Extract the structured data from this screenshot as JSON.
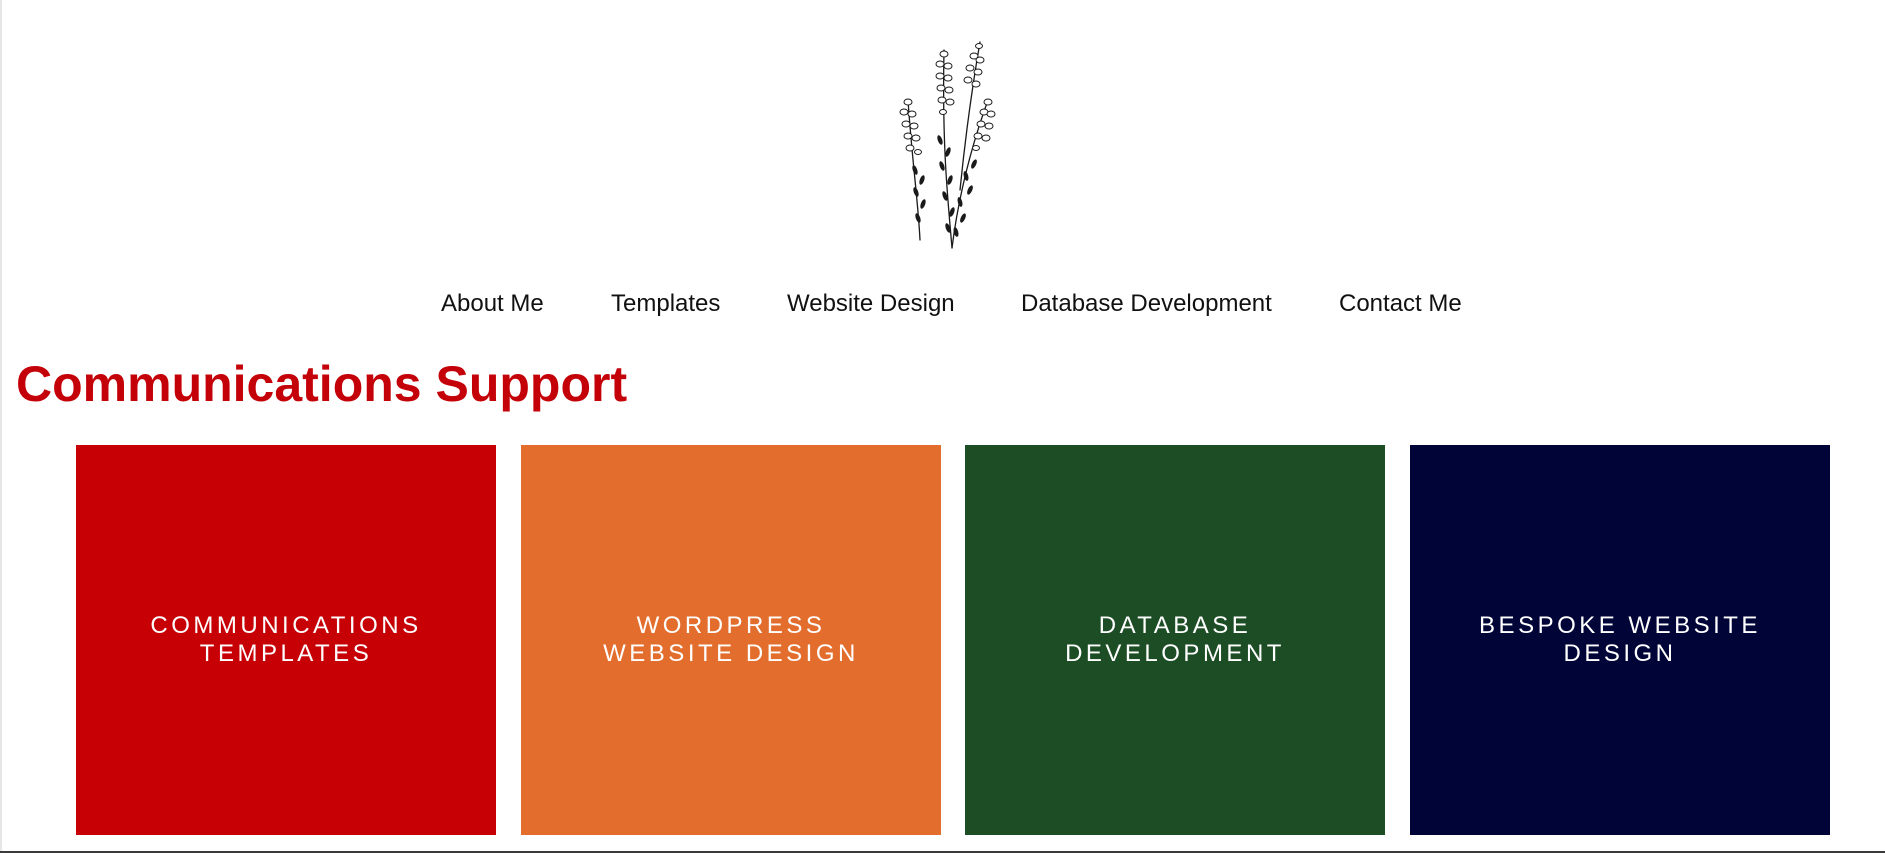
{
  "nav": {
    "items": [
      {
        "label": "About Me"
      },
      {
        "label": "Templates"
      },
      {
        "label": "Website Design"
      },
      {
        "label": "Database Development"
      },
      {
        "label": "Contact Me"
      }
    ]
  },
  "main": {
    "title": "Communications Support",
    "title_color": "#c40008",
    "tiles": [
      {
        "line1": "COMMUNICATIONS",
        "line2": "TEMPLATES",
        "color": "#c70006"
      },
      {
        "line1": "WORDPRESS",
        "line2": "WEBSITE DESIGN",
        "color": "#e36d2c"
      },
      {
        "line1": "DATABASE",
        "line2": "DEVELOPMENT",
        "color": "#1d4d25"
      },
      {
        "line1": "BESPOKE WEBSITE",
        "line2": "DESIGN",
        "color": "#000437"
      }
    ]
  },
  "logo": {
    "icon": "heather-sprig-icon"
  }
}
